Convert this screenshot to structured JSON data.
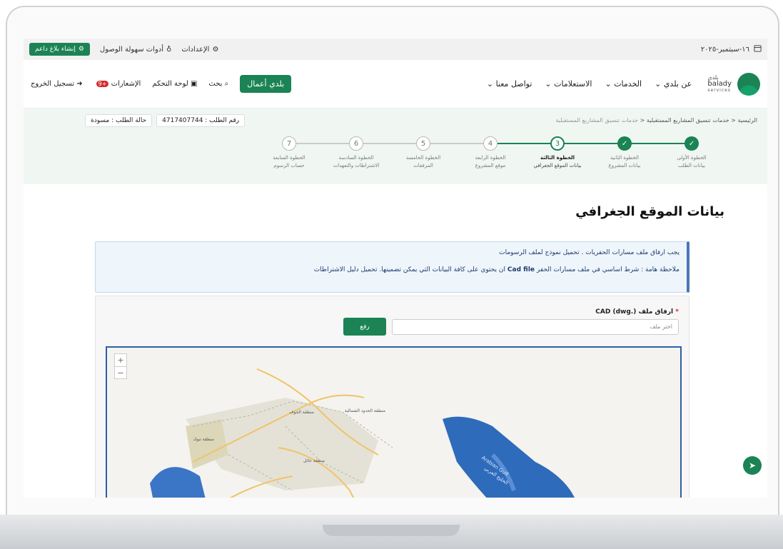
{
  "topbar": {
    "date": "١٦-سبتمبر-٢٠٢٥",
    "settings": "الإعدادات",
    "accessibility": "أدوات سهولة الوصول",
    "report": "إنشاء بلاغ داعم"
  },
  "nav": {
    "brand_ar": "بلدي",
    "brand_en": "balady",
    "brand_sub": "services",
    "menu": [
      "عن بلدي",
      "الخدمات",
      "الاستعلامات",
      "تواصل معنا"
    ],
    "business": "بلدي أعمال",
    "search": "بحث",
    "dashboard": "لوحة التحكم",
    "notifications": "الإشعارات",
    "notif_count": "+9",
    "logout": "تسجيل الخروج"
  },
  "breadcrumb": [
    "الرئيسية",
    "خدمات تنسيق المشاريع المستقبلية",
    "خدمات تنسيق المشاريع المستقبلية"
  ],
  "request": {
    "number": "رقم الطلب : 4717407744",
    "status": "حالة الطلب : مسودة"
  },
  "steps": [
    {
      "num": "✓",
      "title": "الخطوة الأولى",
      "name": "بيانات الطلب",
      "state": "done"
    },
    {
      "num": "✓",
      "title": "الخطوة الثانية",
      "name": "بيانات المشروع",
      "state": "done"
    },
    {
      "num": "3",
      "title": "الخطوة الثالثة",
      "name": "بيانات الموقع الجغرافي",
      "state": "current"
    },
    {
      "num": "4",
      "title": "الخطوة الرابعة",
      "name": "موقع المشروع",
      "state": "todo"
    },
    {
      "num": "5",
      "title": "الخطوة الخامسة",
      "name": "المرفقات",
      "state": "todo"
    },
    {
      "num": "6",
      "title": "الخطوة السادسة",
      "name": "الاشتراطات والتعهدات",
      "state": "todo"
    },
    {
      "num": "7",
      "title": "الخطوة السابعة",
      "name": "حساب الرسوم",
      "state": "todo"
    }
  ],
  "page_title": "بيانات الموقع الجغرافي",
  "notice": {
    "line1": "يجب ارفاق ملف مسارات الحفريات . تحميل نموذج لملف الرسومات",
    "line2_prefix": "ملاحظة هامة : شرط اساسي في ملف مسارات الحفر",
    "line2_bold": "Cad file",
    "line2_suffix": "ان يحتوي على كافة البيانات التي يمكن تضمينها. تحميل دليل الاشتراطات"
  },
  "form": {
    "label": "ارفاق ملف (.CAD (dwg",
    "required": "*",
    "file_placeholder": "اختر ملف",
    "upload": "رفع"
  },
  "map": {
    "zoom_in": "+",
    "zoom_out": "−",
    "labels": [
      "منطقة الجوف",
      "منطقة الحدود الشمالية",
      "منطقة تبوك",
      "منطقة حائل",
      "Arabian Gulf",
      "الخليج العربي"
    ]
  },
  "colors": {
    "primary": "#1b8354",
    "notice_border": "#4a76b8",
    "map_border": "#2e5fa7"
  }
}
